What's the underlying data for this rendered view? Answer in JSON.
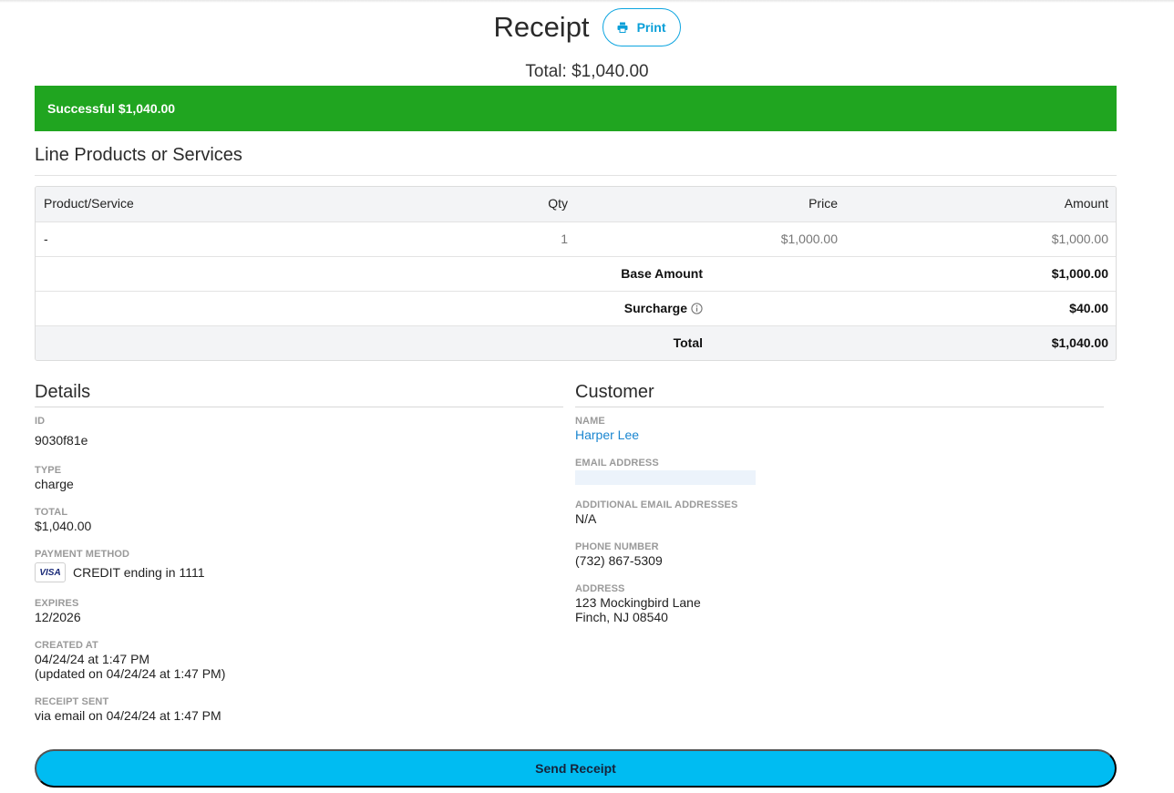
{
  "header": {
    "title": "Receipt",
    "print_label": "Print",
    "total_line": "Total: $1,040.00"
  },
  "status": {
    "text": "Successful $1,040.00",
    "color": "#20a520"
  },
  "line_items": {
    "title": "Line Products or Services",
    "columns": {
      "product": "Product/Service",
      "qty": "Qty",
      "price": "Price",
      "amount": "Amount"
    },
    "rows": [
      {
        "product": "-",
        "qty": "1",
        "price": "$1,000.00",
        "amount": "$1,000.00"
      }
    ],
    "summary": {
      "base_label": "Base Amount",
      "base_value": "$1,000.00",
      "surcharge_label": "Surcharge",
      "surcharge_value": "$40.00",
      "total_label": "Total",
      "total_value": "$1,040.00"
    }
  },
  "details": {
    "title": "Details",
    "id_label": "ID",
    "id_value": "9030f81e",
    "type_label": "TYPE",
    "type_value": "charge",
    "total_label": "TOTAL",
    "total_value": "$1,040.00",
    "payment_label": "PAYMENT METHOD",
    "card_brand": "VISA",
    "payment_value": "CREDIT ending in 1111",
    "expires_label": "EXPIRES",
    "expires_value": "12/2026",
    "created_label": "CREATED AT",
    "created_value": "04/24/24 at 1:47 PM",
    "updated_value": "(updated on 04/24/24 at 1:47 PM)",
    "receipt_label": "RECEIPT SENT",
    "receipt_value": "via email on 04/24/24 at 1:47 PM"
  },
  "customer": {
    "title": "Customer",
    "name_label": "NAME",
    "name_value": "Harper Lee",
    "email_label": "EMAIL ADDRESS",
    "additional_email_label": "ADDITIONAL EMAIL ADDRESSES",
    "additional_email_value": "N/A",
    "phone_label": "PHONE NUMBER",
    "phone_value": "(732) 867-5309",
    "address_label": "ADDRESS",
    "address_line1": "123 Mockingbird Lane",
    "address_line2": "Finch, NJ 08540"
  },
  "actions": {
    "send_receipt_label": "Send Receipt",
    "accent_color": "#00bcf2"
  },
  "icons": {
    "print": "printer-icon",
    "info": "info-icon"
  }
}
